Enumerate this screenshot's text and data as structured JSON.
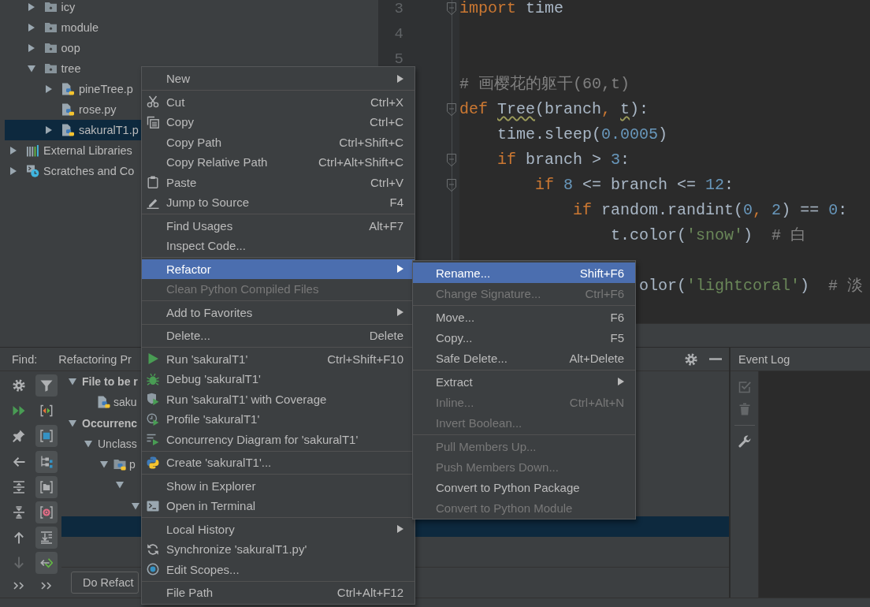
{
  "project_tree": {
    "items": [
      {
        "children": [
          {
            "label": "icy",
            "kind": "folder",
            "expanded": false,
            "selected": false
          },
          {
            "label": "module",
            "kind": "folder",
            "expanded": false,
            "selected": false
          },
          {
            "label": "oop",
            "kind": "folder",
            "expanded": false,
            "selected": false
          },
          {
            "label": "tree",
            "kind": "folder",
            "expanded": true,
            "selected": false,
            "children": [
              {
                "label": "pineTree.p",
                "kind": "script",
                "expanded": false,
                "selected": false
              },
              {
                "label": "rose.py",
                "kind": "script",
                "selected": false
              },
              {
                "label": "sakuralT1.p",
                "kind": "script",
                "expanded": false,
                "selected": true
              }
            ]
          }
        ]
      },
      {
        "label": "External Libraries",
        "kind": "libraries",
        "expanded": false,
        "selected": false
      },
      {
        "label": "Scratches and Co",
        "kind": "scratches",
        "expanded": false,
        "selected": false
      }
    ]
  },
  "editor": {
    "line_numbers": [
      "3",
      "4",
      "5"
    ],
    "lines": [
      {
        "kind": "code",
        "fold": true,
        "tokens": [
          {
            "kind": "keyword",
            "text": "import"
          },
          {
            "kind": "plain",
            "text": " time"
          }
        ]
      },
      {
        "kind": "blank",
        "fold": false
      },
      {
        "kind": "blank",
        "fold": false
      },
      {
        "kind": "code",
        "fold": false,
        "tokens": [
          {
            "kind": "comment",
            "text": "# 画樱花的躯干(60,t)"
          }
        ]
      },
      {
        "kind": "code",
        "fold": true,
        "tokens": [
          {
            "kind": "keyword",
            "text": "def "
          },
          {
            "kind": "warning",
            "text": "Tree"
          },
          {
            "kind": "plain",
            "text": "(branch"
          },
          {
            "kind": "punct",
            "text": ", "
          },
          {
            "kind": "warning",
            "text": "t"
          },
          {
            "kind": "plain",
            "text": "):"
          }
        ]
      },
      {
        "kind": "code",
        "fold": false,
        "tokens": [
          {
            "kind": "plain",
            "text": "    time.sleep("
          },
          {
            "kind": "number",
            "text": "0.0005"
          },
          {
            "kind": "plain",
            "text": ")"
          }
        ]
      },
      {
        "kind": "code",
        "fold": true,
        "tokens": [
          {
            "kind": "keyword",
            "text": "    if"
          },
          {
            "kind": "plain",
            "text": " branch > "
          },
          {
            "kind": "number",
            "text": "3"
          },
          {
            "kind": "plain",
            "text": ":"
          }
        ]
      },
      {
        "kind": "code",
        "fold": true,
        "tokens": [
          {
            "kind": "keyword",
            "text": "        if "
          },
          {
            "kind": "number",
            "text": "8"
          },
          {
            "kind": "plain",
            "text": " <= branch <= "
          },
          {
            "kind": "number",
            "text": "12"
          },
          {
            "kind": "plain",
            "text": ":"
          }
        ]
      },
      {
        "kind": "code",
        "fold": false,
        "tokens": [
          {
            "kind": "keyword",
            "text": "            if"
          },
          {
            "kind": "plain",
            "text": " random.randint("
          },
          {
            "kind": "number",
            "text": "0"
          },
          {
            "kind": "punct",
            "text": ", "
          },
          {
            "kind": "number",
            "text": "2"
          },
          {
            "kind": "plain",
            "text": ") == "
          },
          {
            "kind": "number",
            "text": "0"
          },
          {
            "kind": "plain",
            "text": ":"
          }
        ]
      },
      {
        "kind": "code",
        "fold": false,
        "tokens": [
          {
            "kind": "plain",
            "text": "                t.color("
          },
          {
            "kind": "string",
            "text": "'snow'"
          },
          {
            "kind": "plain",
            "text": ")  "
          },
          {
            "kind": "comment",
            "text": "# 白"
          }
        ]
      },
      {
        "kind": "blank",
        "fold": false
      },
      {
        "kind": "code",
        "fold": false,
        "tokens": [
          {
            "kind": "plain",
            "text": "                   olor("
          },
          {
            "kind": "string",
            "text": "'lightcoral'"
          },
          {
            "kind": "plain",
            "text": ")  "
          },
          {
            "kind": "comment",
            "text": "# 淡"
          }
        ]
      }
    ]
  },
  "context_menu": {
    "groups": [
      {
        "items": [
          {
            "label": "New",
            "submenu": true,
            "selected": false,
            "disabled": false
          }
        ]
      },
      {
        "items": [
          {
            "label": "Cut",
            "shortcut": "Ctrl+X",
            "submenu": false,
            "selected": false,
            "disabled": false
          },
          {
            "label": "Copy",
            "shortcut": "Ctrl+C",
            "submenu": false,
            "selected": false,
            "disabled": false
          },
          {
            "label": "Copy Path",
            "shortcut": "Ctrl+Shift+C",
            "submenu": false,
            "selected": false,
            "disabled": false
          },
          {
            "label": "Copy Relative Path",
            "shortcut": "Ctrl+Alt+Shift+C",
            "submenu": false,
            "selected": false,
            "disabled": false
          },
          {
            "label": "Paste",
            "shortcut": "Ctrl+V",
            "submenu": false,
            "selected": false,
            "disabled": false
          },
          {
            "label": "Jump to Source",
            "shortcut": "F4",
            "submenu": false,
            "selected": false,
            "disabled": false
          }
        ]
      },
      {
        "items": [
          {
            "label": "Find Usages",
            "shortcut": "Alt+F7",
            "submenu": false,
            "selected": false,
            "disabled": false
          },
          {
            "label": "Inspect Code...",
            "submenu": false,
            "selected": false,
            "disabled": false
          }
        ]
      },
      {
        "items": [
          {
            "label": "Refactor",
            "submenu": true,
            "selected": true,
            "disabled": false
          },
          {
            "label": "Clean Python Compiled Files",
            "submenu": false,
            "selected": false,
            "disabled": true
          }
        ]
      },
      {
        "items": [
          {
            "label": "Add to Favorites",
            "submenu": true,
            "selected": false,
            "disabled": false
          }
        ]
      },
      {
        "items": [
          {
            "label": "Delete...",
            "shortcut": "Delete",
            "submenu": false,
            "selected": false,
            "disabled": false
          }
        ]
      },
      {
        "items": [
          {
            "label": "Run 'sakuralT1'",
            "shortcut": "Ctrl+Shift+F10",
            "submenu": false,
            "selected": false,
            "disabled": false
          },
          {
            "label": "Debug 'sakuralT1'",
            "submenu": false,
            "selected": false,
            "disabled": false
          },
          {
            "label": "Run 'sakuralT1' with Coverage",
            "submenu": false,
            "selected": false,
            "disabled": false
          },
          {
            "label": "Profile 'sakuralT1'",
            "submenu": false,
            "selected": false,
            "disabled": false
          },
          {
            "label": "Concurrency Diagram for 'sakuralT1'",
            "submenu": false,
            "selected": false,
            "disabled": false
          }
        ]
      },
      {
        "items": [
          {
            "label": "Create 'sakuralT1'...",
            "submenu": false,
            "selected": false,
            "disabled": false
          }
        ]
      },
      {
        "items": [
          {
            "label": "Show in Explorer",
            "submenu": false,
            "selected": false,
            "disabled": false
          },
          {
            "label": "Open in Terminal",
            "submenu": false,
            "selected": false,
            "disabled": false
          }
        ]
      },
      {
        "items": [
          {
            "label": "Local History",
            "submenu": true,
            "selected": false,
            "disabled": false
          },
          {
            "label": "Synchronize 'sakuralT1.py'",
            "submenu": false,
            "selected": false,
            "disabled": false
          },
          {
            "label": "Edit Scopes...",
            "submenu": false,
            "selected": false,
            "disabled": false
          }
        ]
      },
      {
        "items": [
          {
            "label": "File Path",
            "shortcut": "Ctrl+Alt+F12",
            "submenu": false,
            "selected": false,
            "disabled": false
          }
        ]
      }
    ]
  },
  "refactor_submenu": {
    "groups": [
      {
        "items": [
          {
            "label": "Rename...",
            "shortcut": "Shift+F6",
            "submenu": false,
            "selected": true,
            "disabled": false
          },
          {
            "label": "Change Signature...",
            "shortcut": "Ctrl+F6",
            "submenu": false,
            "selected": false,
            "disabled": true
          }
        ]
      },
      {
        "items": [
          {
            "label": "Move...",
            "shortcut": "F6",
            "submenu": false,
            "selected": false,
            "disabled": false
          },
          {
            "label": "Copy...",
            "shortcut": "F5",
            "submenu": false,
            "selected": false,
            "disabled": false
          },
          {
            "label": "Safe Delete...",
            "shortcut": "Alt+Delete",
            "submenu": false,
            "selected": false,
            "disabled": false
          }
        ]
      },
      {
        "items": [
          {
            "label": "Extract",
            "submenu": true,
            "selected": false,
            "disabled": false
          },
          {
            "label": "Inline...",
            "shortcut": "Ctrl+Alt+N",
            "submenu": false,
            "selected": false,
            "disabled": true
          },
          {
            "label": "Invert Boolean...",
            "submenu": false,
            "selected": false,
            "disabled": true
          }
        ]
      },
      {
        "items": [
          {
            "label": "Pull Members Up...",
            "submenu": false,
            "selected": false,
            "disabled": true
          },
          {
            "label": "Push Members Down...",
            "submenu": false,
            "selected": false,
            "disabled": true
          },
          {
            "label": "Convert to Python Package",
            "submenu": false,
            "selected": false,
            "disabled": false
          },
          {
            "label": "Convert to Python Module",
            "submenu": false,
            "selected": false,
            "disabled": true
          }
        ]
      }
    ]
  },
  "find_panel": {
    "title": "Find:",
    "tab": "Refactoring Pr",
    "actions": [
      {
        "disabled": false
      },
      {
        "disabled": false
      },
      {
        "disabled": false
      },
      {
        "disabled": false
      },
      {
        "disabled": false
      },
      {
        "disabled": false
      },
      {
        "disabled": false
      },
      {
        "disabled": true
      },
      {
        "disabled": false
      }
    ],
    "view_options": [
      {
        "on": true
      },
      {
        "on": false
      },
      {
        "on": true
      },
      {
        "on": true
      },
      {
        "on": true
      },
      {
        "on": true
      },
      {
        "on": true
      },
      {
        "on": true
      },
      {
        "on": false
      }
    ],
    "tree": [
      {
        "label": "File to be r",
        "kind": "group",
        "expanded": true,
        "selected": false,
        "children": [
          {
            "label": "saku",
            "kind": "script",
            "selected": false
          }
        ]
      },
      {
        "label": "Occurrenc",
        "kind": "group",
        "expanded": true,
        "selected": false,
        "children": [
          {
            "label": "Unclass",
            "expanded": true,
            "selected": false,
            "children": [
              {
                "label": "p",
                "kind": "package",
                "expanded": true,
                "selected": false,
                "children": [
                  {
                    "expanded": true,
                    "selected": false,
                    "children": [
                      {
                        "expanded": true,
                        "selected": false,
                        "children": [
                          {
                            "selected": true
                          }
                        ]
                      }
                    ]
                  }
                ]
              }
            ]
          }
        ]
      }
    ],
    "button": "Do Refact"
  },
  "event_log": {
    "title": "Event Log",
    "action_groups": [
      {
        "items": [
          {
            "disabled": true
          },
          {
            "disabled": true
          }
        ]
      },
      {
        "items": [
          {
            "disabled": false
          }
        ]
      }
    ]
  }
}
